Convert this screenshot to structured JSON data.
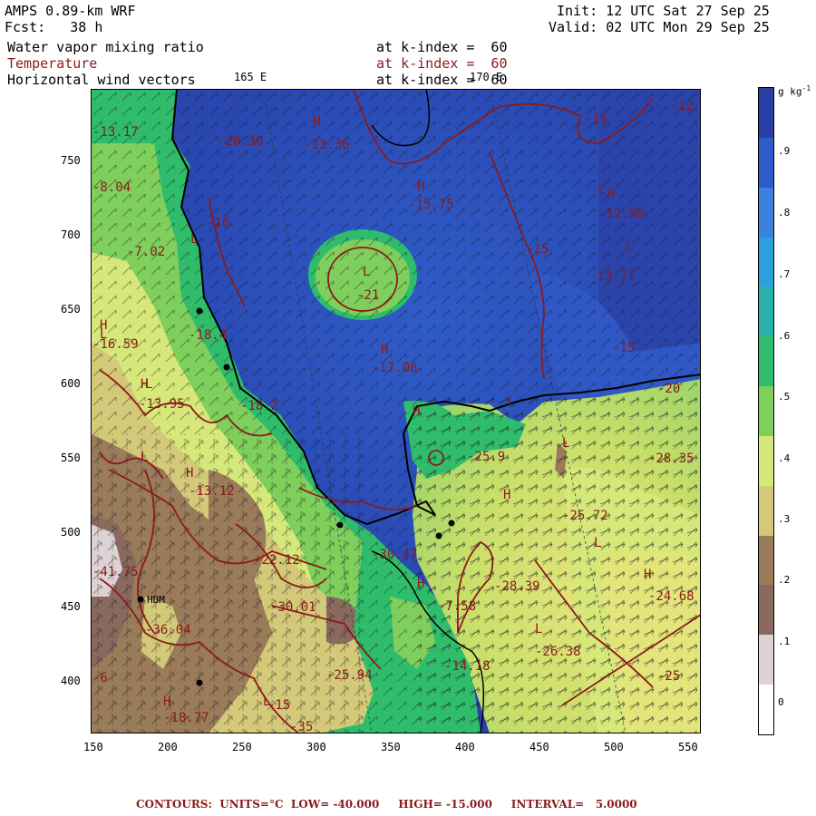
{
  "header": {
    "model": "AMPS 0.89-km WRF",
    "forecast": "Fcst:   38 h",
    "init": "Init: 12 UTC Sat 27 Sep 25",
    "valid": "Valid: 02 UTC Mon 29 Sep 25"
  },
  "fields": [
    {
      "name": "Water vapor mixing ratio",
      "level": "at k-index =  60",
      "color": "#000000"
    },
    {
      "name": "Temperature",
      "level": "at k-index =  60",
      "color": "#8b1a1a"
    },
    {
      "name": "Horizontal wind vectors",
      "level": "at k-index =  60",
      "color": "#000000"
    }
  ],
  "lon_labels": [
    "165 E",
    "170 E"
  ],
  "x_axis": {
    "ticks": [
      "150",
      "200",
      "250",
      "300",
      "350",
      "400",
      "450",
      "500",
      "550"
    ]
  },
  "y_axis": {
    "ticks": [
      "750",
      "700",
      "650",
      "600",
      "550",
      "500",
      "450",
      "400"
    ]
  },
  "colorbar": {
    "unit": "g kg",
    "unit_sup": "-1",
    "labels": [
      ".9",
      ".8",
      ".7",
      ".6",
      ".5",
      ".4",
      ".3",
      ".2",
      ".1",
      "0"
    ],
    "colors": [
      "#2a3fa6",
      "#2f5cc8",
      "#3c80e0",
      "#2aa0de",
      "#2bb2a8",
      "#2fbd6c",
      "#7ecf5c",
      "#d6e87a",
      "#d3c978",
      "#9a7b5a",
      "#8a6a5e",
      "#ddd2d4",
      "#ffffff"
    ]
  },
  "temperature_labels": [
    {
      "text": "-20.36"
    },
    {
      "text": "-13.36"
    },
    {
      "text": "-15"
    },
    {
      "text": "-12"
    },
    {
      "text": "-15.75"
    },
    {
      "text": "-12.56"
    },
    {
      "text": "-15"
    },
    {
      "text": "-13.71"
    },
    {
      "text": "-21"
    },
    {
      "text": "-17.08"
    },
    {
      "text": "-15"
    },
    {
      "text": "-20"
    },
    {
      "text": "-25.9"
    },
    {
      "text": "-28.35"
    },
    {
      "text": "-25.72"
    },
    {
      "text": "-28.39"
    },
    {
      "text": "-24.68"
    },
    {
      "text": "-26.38"
    },
    {
      "text": "-25"
    },
    {
      "text": "-14.18"
    },
    {
      "text": "-30.47"
    },
    {
      "text": "-22.12"
    },
    {
      "text": "-30.01"
    },
    {
      "text": "-25.94"
    },
    {
      "text": "-36.04"
    },
    {
      "text": "-13.12"
    },
    {
      "text": "-13.95"
    },
    {
      "text": "-16.59"
    },
    {
      "text": "-18.4"
    },
    {
      "text": "-18.2"
    },
    {
      "text": "-13.17"
    },
    {
      "text": "-8.04"
    },
    {
      "text": "-7.02"
    },
    {
      "text": "-16"
    },
    {
      "text": "-41.75"
    },
    {
      "text": "-7.58"
    },
    {
      "text": "-18.77"
    },
    {
      "text": "-15"
    },
    {
      "text": "-6"
    },
    {
      "text": "-35"
    }
  ],
  "pressure_markers": [
    "H",
    "L",
    "H",
    "L",
    "H",
    "L",
    "H",
    "L",
    "H",
    "L",
    "H",
    "L",
    "H",
    "L",
    "H",
    "L",
    "H",
    "L",
    "H",
    "L",
    "H",
    "L",
    "H",
    "L"
  ],
  "station": "HDM",
  "footer": {
    "contours": "CONTOURS:  UNITS=°C  LOW= -40.000     HIGH= -15.000     INTERVAL=   5.0000"
  }
}
